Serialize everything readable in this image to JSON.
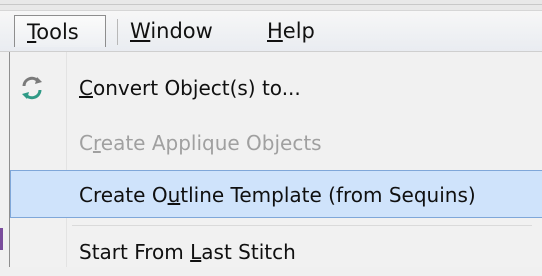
{
  "menubar": {
    "items": [
      {
        "label": "Tools",
        "mnemonic": "T",
        "rest": "ools",
        "active": true
      },
      {
        "label": "Window",
        "mnemonic": "W",
        "rest": "indow",
        "active": false
      },
      {
        "label": "Help",
        "mnemonic": "H",
        "rest": "elp",
        "active": false
      }
    ]
  },
  "dropdown": {
    "items": [
      {
        "label": "Convert Object(s) to...",
        "prefix": "",
        "mnemonic": "C",
        "suffix": "onvert Object(s) to...",
        "enabled": true,
        "selected": false,
        "icon": "convert-arrows-icon"
      },
      {
        "label": "Create Applique Objects",
        "prefix": "C",
        "mnemonic": "r",
        "suffix": "eate Applique Objects",
        "enabled": false,
        "selected": false,
        "icon": ""
      },
      {
        "label": "Create Outline Template (from Sequins)",
        "prefix": "Create O",
        "mnemonic": "u",
        "suffix": "tline Template (from Sequins)",
        "enabled": true,
        "selected": true,
        "icon": ""
      },
      {
        "label": "Start From Last Stitch",
        "prefix": "Start From ",
        "mnemonic": "L",
        "suffix": "ast Stitch",
        "enabled": true,
        "selected": false,
        "icon": ""
      }
    ]
  },
  "colors": {
    "selection_bg": "#cfe3fb",
    "selection_border": "#7fa7d9",
    "disabled_text": "#a0a0a0",
    "icon_accent": "#2f9a86"
  }
}
